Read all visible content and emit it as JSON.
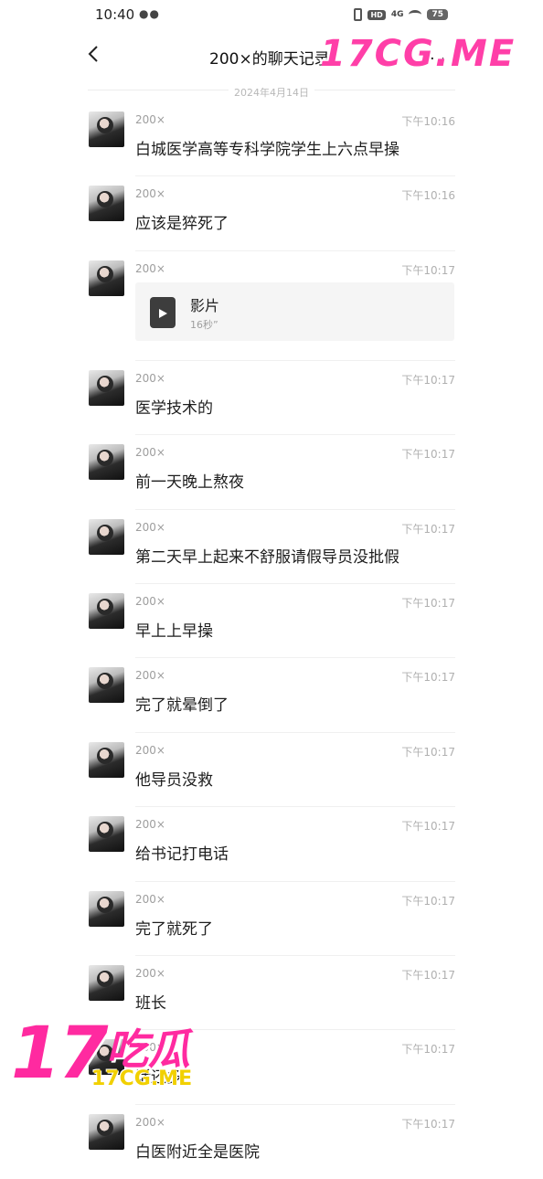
{
  "status_bar": {
    "time": "10:40",
    "dots": "●●",
    "hd": "HD",
    "network": "4G",
    "battery": "75"
  },
  "header": {
    "title": "200×的聊天记录",
    "more": "…"
  },
  "date_separator": "2024年4月14日",
  "messages": [
    {
      "sender": "200×",
      "time": "下午10:16",
      "text": "白城医学高等专科学院学生上六点早操"
    },
    {
      "sender": "200×",
      "time": "下午10:16",
      "text": "应该是猝死了"
    },
    {
      "sender": "200×",
      "time": "下午10:17",
      "file": {
        "name": "影片",
        "duration": "16秒”"
      }
    },
    {
      "sender": "200×",
      "time": "下午10:17",
      "text": "医学技术的"
    },
    {
      "sender": "200×",
      "time": "下午10:17",
      "text": "前一天晚上熬夜"
    },
    {
      "sender": "200×",
      "time": "下午10:17",
      "text": "第二天早上起来不舒服请假导员没批假"
    },
    {
      "sender": "200×",
      "time": "下午10:17",
      "text": "早上上早操"
    },
    {
      "sender": "200×",
      "time": "下午10:17",
      "text": "完了就晕倒了"
    },
    {
      "sender": "200×",
      "time": "下午10:17",
      "text": "他导员没救"
    },
    {
      "sender": "200×",
      "time": "下午10:17",
      "text": "给书记打电话"
    },
    {
      "sender": "200×",
      "time": "下午10:17",
      "text": "完了就死了"
    },
    {
      "sender": "200×",
      "time": "下午10:17",
      "text": "班长"
    },
    {
      "sender": "200×",
      "time": "下午10:17",
      "text": "话还多"
    },
    {
      "sender": "200×",
      "time": "下午10:17",
      "text": "白医附近全是医院"
    }
  ],
  "watermark": {
    "top": "17CG.ME",
    "logo_number": "17",
    "logo_text": "吃瓜",
    "logo_url": "17CG.ME"
  }
}
